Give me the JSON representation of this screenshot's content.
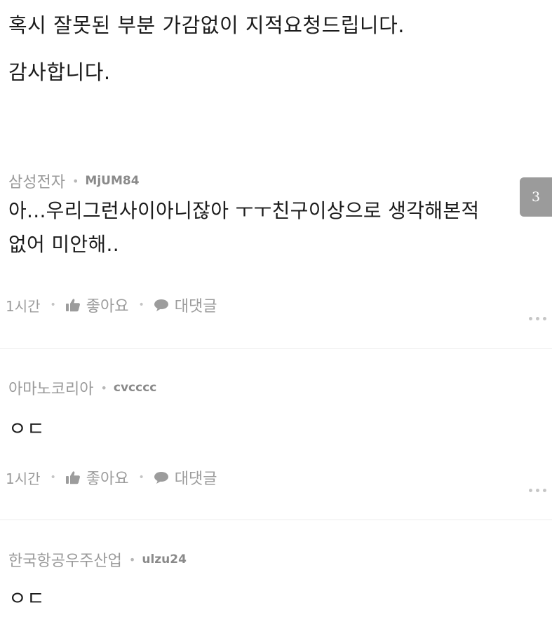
{
  "post": {
    "line1": "혹시 잘못된 부분 가감없이 지적요청드립니다.",
    "line2": "감사합니다."
  },
  "page_badge": "3",
  "comments": [
    {
      "company": "삼성전자",
      "author": "MjUM84",
      "text_line1": "아...우리그런사이아니잖아 ㅜㅜ친구이상으로 생각해본적",
      "text_line2": "없어 미안해..",
      "time": "1시간",
      "like_label": "좋아요",
      "reply_label": "대댓글"
    },
    {
      "company": "아마노코리아",
      "author": "cvcccc",
      "text_line1": "ㅇㄷ",
      "time": "1시간",
      "like_label": "좋아요",
      "reply_label": "대댓글"
    },
    {
      "company": "한국항공우주산업",
      "author": "ulzu24",
      "text_line1": "ㅇㄷ"
    }
  ],
  "icons": {
    "like": "thumbs-up-icon",
    "reply": "speech-bubble-icon",
    "more": "more-dots-icon"
  },
  "colors": {
    "meta_text": "#9a9a9a",
    "body_text": "#1c1c1c",
    "badge_bg": "#9b9b9b"
  }
}
